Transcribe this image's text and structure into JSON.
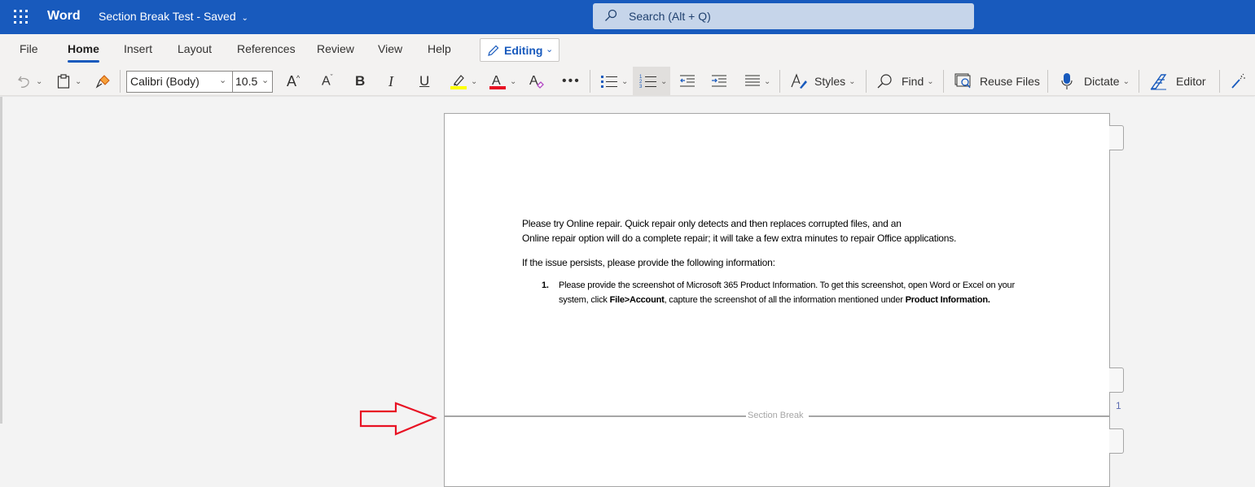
{
  "titlebar": {
    "app_name": "Word",
    "doc_title": "Section Break Test",
    "status": "Saved",
    "search_placeholder": "Search (Alt + Q)",
    "accent_color": "#185abd"
  },
  "ribbon": {
    "tabs": [
      {
        "label": "File",
        "active": false
      },
      {
        "label": "Home",
        "active": true
      },
      {
        "label": "Insert",
        "active": false
      },
      {
        "label": "Layout",
        "active": false
      },
      {
        "label": "References",
        "active": false
      },
      {
        "label": "Review",
        "active": false
      },
      {
        "label": "View",
        "active": false
      },
      {
        "label": "Help",
        "active": false
      }
    ],
    "mode_button": "Editing",
    "font_name": "Calibri (Body)",
    "font_size": "10.5",
    "styles_label": "Styles",
    "find_label": "Find",
    "reuse_files_label": "Reuse Files",
    "dictate_label": "Dictate",
    "editor_label": "Editor",
    "highlight_color": "#ffff00",
    "font_color": "#e81123"
  },
  "document": {
    "paragraph1_line1": "Please try Online repair. Quick repair only detects and then replaces corrupted files, and an",
    "paragraph1_line2": "Online repair option will do a complete repair; it will take a few extra minutes to repair Office applications.",
    "paragraph2": "If the issue persists, please provide the following information:",
    "list": [
      {
        "number": "1.",
        "text_part1": "Please provide the screenshot of Microsoft 365 Product Information. To get this screenshot, open Word or Excel on your system, click ",
        "text_bold1": "File>Account",
        "text_part2": ", capture the screenshot of all the information mentioned under ",
        "text_bold2": "Product Information."
      }
    ],
    "section_break_label": "Section Break",
    "page_number": "1"
  }
}
